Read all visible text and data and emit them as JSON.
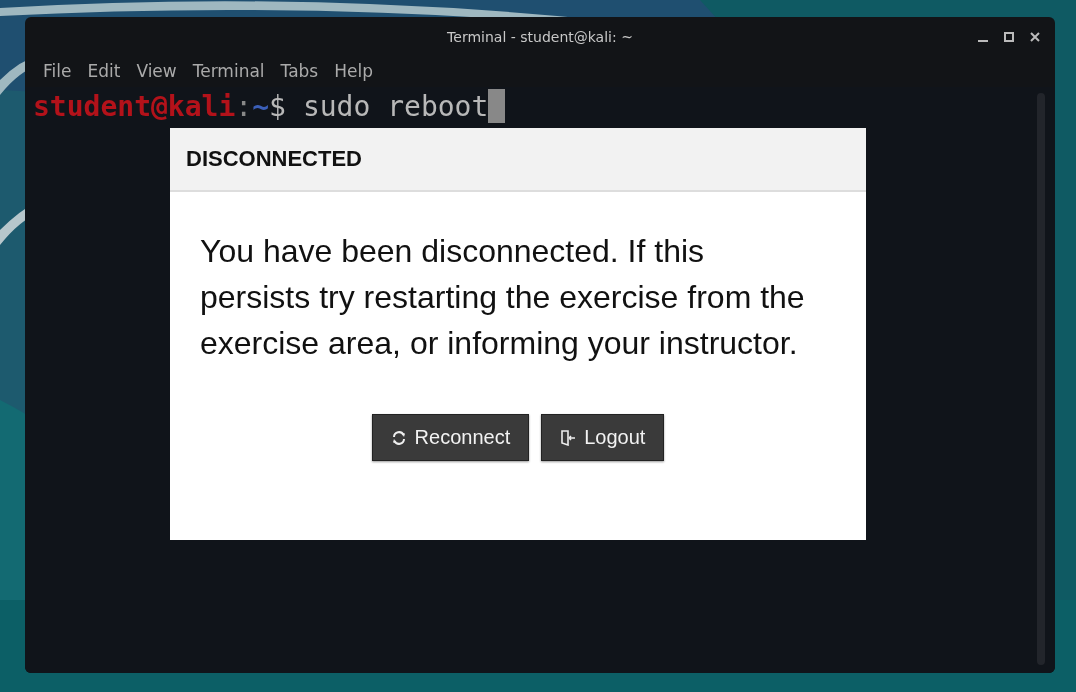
{
  "window": {
    "title": "Terminal - student@kali: ~"
  },
  "menu": [
    "File",
    "Edit",
    "View",
    "Terminal",
    "Tabs",
    "Help"
  ],
  "prompt": {
    "user_host": "student@kali",
    "separator": ":",
    "path": "~",
    "symbol": "$",
    "command": "sudo reboot"
  },
  "dialog": {
    "title": "DISCONNECTED",
    "message": "You have been disconnected. If this persists try restarting the exercise from the exercise area, or informing your instructor.",
    "buttons": [
      {
        "kind": "reconnect",
        "label": "Reconnect"
      },
      {
        "kind": "logout",
        "label": "Logout"
      }
    ]
  }
}
